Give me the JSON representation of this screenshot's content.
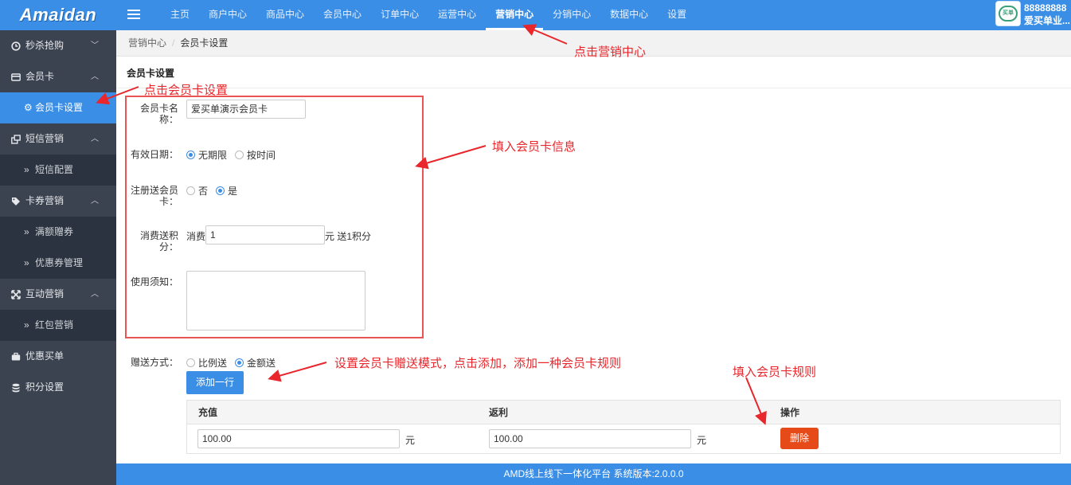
{
  "app": {
    "logo": "Amaidan",
    "footer": "AMD线上线下一体化平台 系统版本:2.0.0.0"
  },
  "topnav": {
    "items": [
      "主页",
      "商户中心",
      "商品中心",
      "会员中心",
      "订单中心",
      "运营中心",
      "营销中心",
      "分销中心",
      "数据中心",
      "设置"
    ],
    "active_index": 6
  },
  "user": {
    "id": "88888888",
    "name": "爱买单业...",
    "avatar_text": "买单"
  },
  "sidebar": {
    "g1": "秒杀抢购",
    "g2": "会员卡",
    "g2_sub": "会员卡设置",
    "g3": "短信营销",
    "g3_sub": "短信配置",
    "g4": "卡券营销",
    "g4_sub1": "满额赠券",
    "g4_sub2": "优惠券管理",
    "g5": "互动营销",
    "g5_sub": "红包营销",
    "g6": "优惠买单",
    "g7": "积分设置"
  },
  "breadcrumb": {
    "parent": "营销中心",
    "sep": "/",
    "current": "会员卡设置"
  },
  "form": {
    "title": "会员卡设置",
    "name_label": "会员卡名称：",
    "name_value": "爱买单演示会员卡",
    "validity_label": "有效日期：",
    "validity_opt1": "无期限",
    "validity_opt2": "按时间",
    "register_label": "注册送会员卡：",
    "register_opt1": "否",
    "register_opt2": "是",
    "points_label": "消费送积分：",
    "points_prefix": "消费",
    "points_value": "1",
    "points_suffix": "元 送1积分",
    "notice_label": "使用须知：",
    "gift_label": "赠送方式：",
    "gift_opt1": "比例送",
    "gift_opt2": "金额送",
    "add_row": "添加一行"
  },
  "rules_table": {
    "headers": [
      "充值",
      "返利",
      "操作"
    ],
    "rows": [
      {
        "recharge": "100.00",
        "rebate": "100.00",
        "unit": "元",
        "delete": "删除"
      }
    ]
  },
  "annotations": {
    "a1": "点击营销中心",
    "a2": "点击会员卡设置",
    "a3": "填入会员卡信息",
    "a4": "设置会员卡赠送模式，点击添加，添加一种会员卡规则",
    "a5": "填入会员卡规则"
  },
  "colors": {
    "primary": "#3a8ee6",
    "sidebar": "#3b4250",
    "danger": "#e64a19",
    "annotation": "#e8262b"
  }
}
